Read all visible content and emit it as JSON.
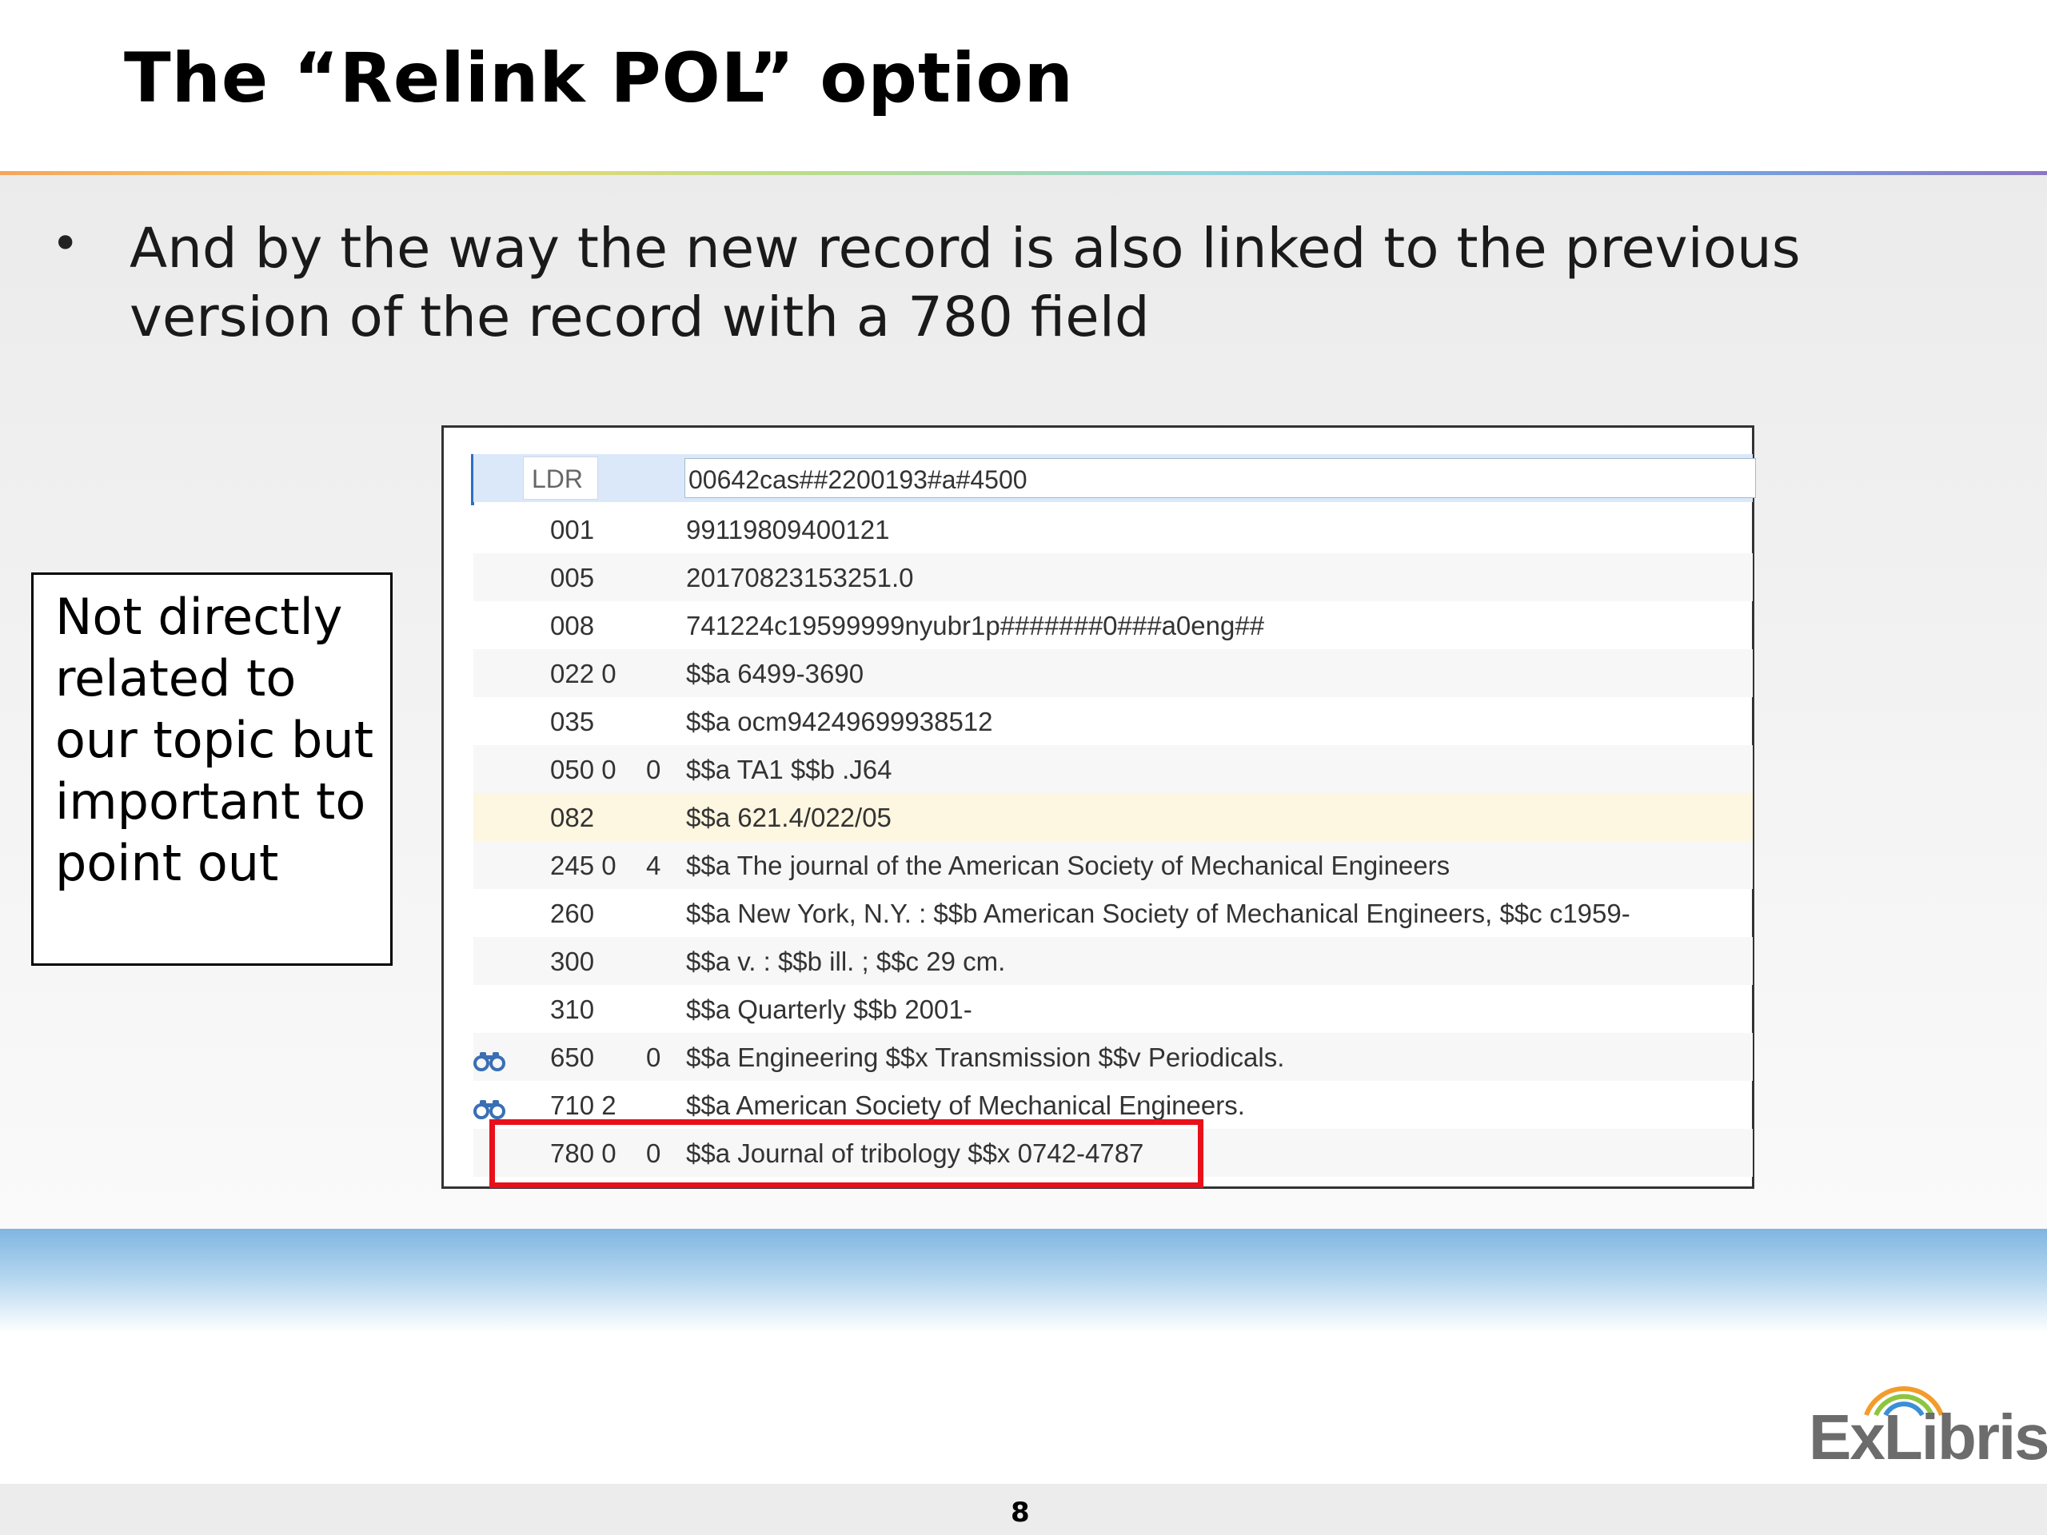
{
  "slide": {
    "title": "The “Relink POL” option",
    "bullet_symbol": "•",
    "bullet_text": "And by the way the new record is also linked to the previous version of the record with a 780 field",
    "callout_text": "Not directly related to our topic but important to point out",
    "page_number": "8",
    "logo_text": "ExLibris"
  },
  "record": {
    "ldr": {
      "tag": "LDR",
      "value": "00642cas##2200193#a#4500"
    },
    "fields": [
      {
        "tag": "001",
        "ind2": "",
        "value": "99119809400121"
      },
      {
        "tag": "005",
        "ind2": "",
        "value": "20170823153251.0"
      },
      {
        "tag": "008",
        "ind2": "",
        "value": "741224c19599999nyubr1p#######0###a0eng##"
      },
      {
        "tag": "022 0",
        "ind2": "",
        "value": "$$a 6499-3690"
      },
      {
        "tag": "035",
        "ind2": "",
        "value": "$$a ocm94249699938512"
      },
      {
        "tag": "050 0",
        "ind2": "0",
        "value": "$$a TA1 $$b .J64"
      },
      {
        "tag": "082",
        "ind2": "",
        "value": "$$a 621.4/022/05"
      },
      {
        "tag": "245 0",
        "ind2": "4",
        "value": "$$a The journal of the American Society of Mechanical Engineers"
      },
      {
        "tag": "260",
        "ind2": "",
        "value": "$$a New York, N.Y. : $$b American Society of Mechanical Engineers, $$c c1959-"
      },
      {
        "tag": "300",
        "ind2": "",
        "value": "$$a v. : $$b ill. ; $$c 29 cm."
      },
      {
        "tag": "310",
        "ind2": "",
        "value": "$$a Quarterly $$b 2001-"
      },
      {
        "tag": "650",
        "ind2": "0",
        "value": "$$a Engineering $$x Transmission $$v Periodicals."
      },
      {
        "tag": "710 2",
        "ind2": "",
        "value": "$$a American Society of Mechanical Engineers."
      },
      {
        "tag": "780 0",
        "ind2": "0",
        "value": "$$a Journal of tribology $$x 0742-4787"
      }
    ]
  },
  "icons": {
    "authority_search": "binoculars-icon"
  },
  "colors": {
    "highlight_border": "#e8101a",
    "row_highlight": "#fdf6e0",
    "row_stripe": "#f7f7f7",
    "scroll_indicator": "#2e6fc2",
    "logo_gray": "#6c6c6c"
  }
}
